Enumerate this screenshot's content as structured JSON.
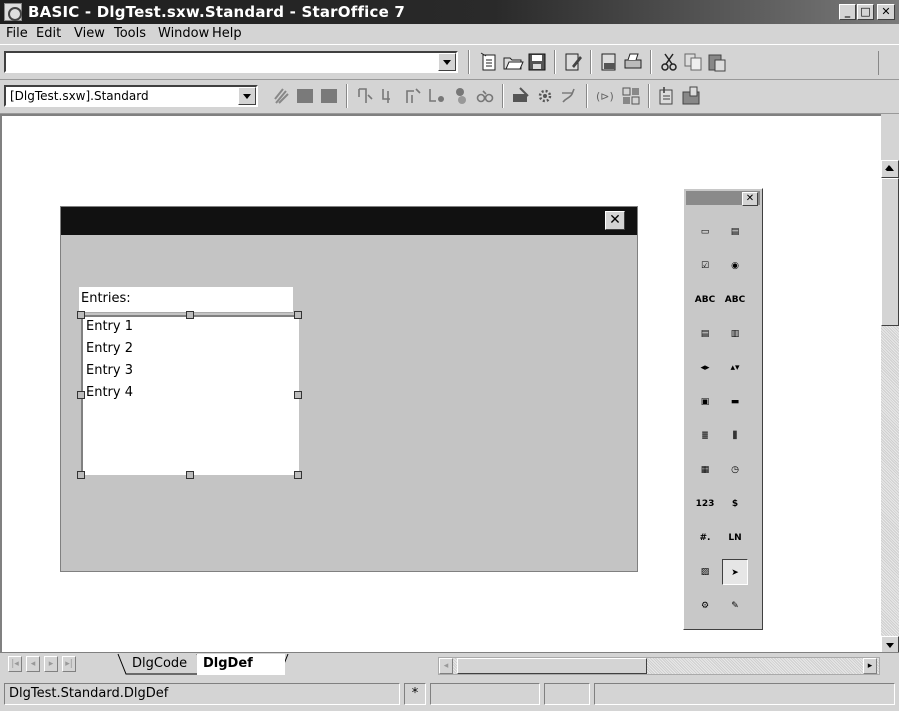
{
  "window": {
    "title": "BASIC - DlgTest.sxw.Standard - StarOffice 7",
    "minimize_label": "_",
    "maximize_label": "□",
    "close_label": "✕"
  },
  "menu": {
    "items": [
      {
        "label": "File"
      },
      {
        "label": "Edit"
      },
      {
        "label": "View"
      },
      {
        "label": "Tools"
      },
      {
        "label": "Window"
      },
      {
        "label": "Help"
      }
    ]
  },
  "url_bar": {
    "value": ""
  },
  "library_selector": {
    "value": "[DlgTest.sxw].Standard"
  },
  "dialog": {
    "close_label": "✕",
    "label_text": "Entries:",
    "list_entries": [
      "Entry 1",
      "Entry 2",
      "Entry 3",
      "Entry 4"
    ]
  },
  "toolbox": {
    "close_label": "✕",
    "tools": [
      {
        "name": "button-tool",
        "glyph": "▭"
      },
      {
        "name": "image-control-tool",
        "glyph": "▤"
      },
      {
        "name": "check-box-tool",
        "glyph": "☑"
      },
      {
        "name": "option-button-tool",
        "glyph": "◉"
      },
      {
        "name": "label-tool",
        "glyph": "ABC"
      },
      {
        "name": "text-box-tool",
        "glyph": "ABC"
      },
      {
        "name": "list-box-tool",
        "glyph": "▤"
      },
      {
        "name": "combo-box-tool",
        "glyph": "▥"
      },
      {
        "name": "horizontal-scrollbar-tool",
        "glyph": "◂▸"
      },
      {
        "name": "vertical-scrollbar-tool",
        "glyph": "▴▾"
      },
      {
        "name": "group-box-tool",
        "glyph": "▣"
      },
      {
        "name": "progress-bar-tool",
        "glyph": "▬"
      },
      {
        "name": "horizontal-line-tool",
        "glyph": "≣"
      },
      {
        "name": "vertical-line-tool",
        "glyph": "⫼"
      },
      {
        "name": "date-field-tool",
        "glyph": "▦"
      },
      {
        "name": "time-field-tool",
        "glyph": "◷"
      },
      {
        "name": "numeric-field-tool",
        "glyph": "123"
      },
      {
        "name": "currency-field-tool",
        "glyph": "$"
      },
      {
        "name": "formatted-field-tool",
        "glyph": "#."
      },
      {
        "name": "pattern-field-tool",
        "glyph": "LN"
      },
      {
        "name": "file-selection-tool",
        "glyph": "▨"
      },
      {
        "name": "select-tool",
        "glyph": "➤"
      },
      {
        "name": "properties-tool",
        "glyph": "⚙"
      },
      {
        "name": "activate-test-mode-tool",
        "glyph": "✎"
      }
    ]
  },
  "tabs": [
    {
      "label": "DlgCode",
      "active": false
    },
    {
      "label": "DlgDef",
      "active": true
    }
  ],
  "status": {
    "location": "DlgTest.Standard.DlgDef",
    "modified_marker": "*"
  }
}
